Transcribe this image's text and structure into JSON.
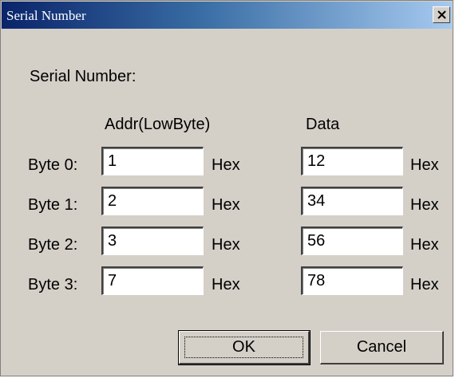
{
  "window": {
    "title": "Serial Number"
  },
  "dialog": {
    "heading": "Serial Number:",
    "columns": {
      "addr": "Addr(LowByte)",
      "data": "Data"
    },
    "unit": "Hex",
    "rows": [
      {
        "label": "Byte 0:",
        "addr": "1",
        "data": "12"
      },
      {
        "label": "Byte 1:",
        "addr": "2",
        "data": "34"
      },
      {
        "label": "Byte 2:",
        "addr": "3",
        "data": "56"
      },
      {
        "label": "Byte 3:",
        "addr": "7",
        "data": "78"
      }
    ],
    "buttons": {
      "ok": "OK",
      "cancel": "Cancel"
    }
  },
  "icons": {
    "close": "close-icon"
  }
}
